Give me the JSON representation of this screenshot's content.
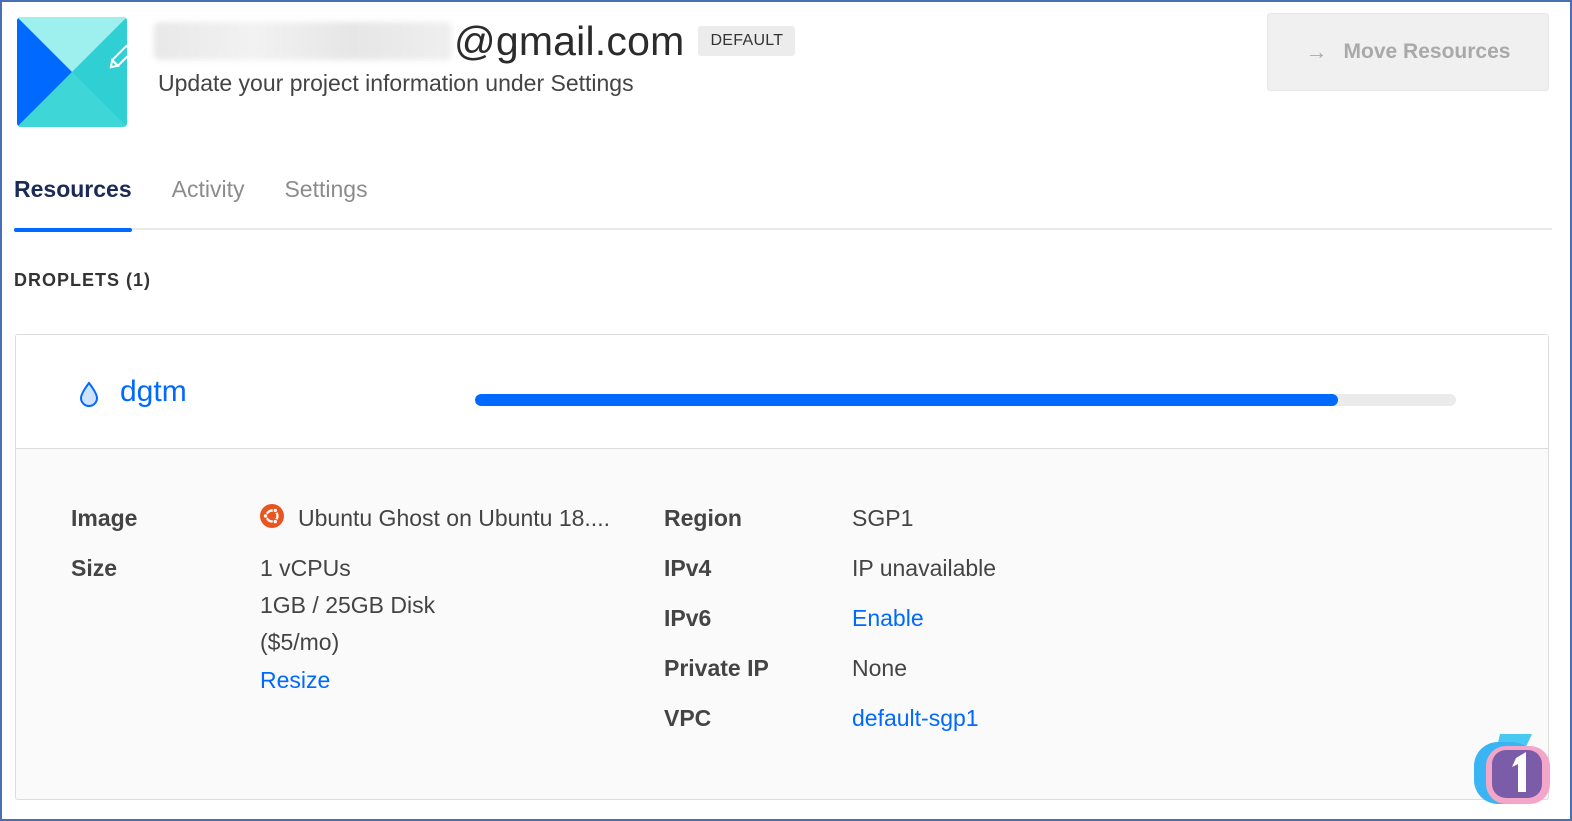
{
  "header": {
    "email_domain": "@gmail.com",
    "badge": "DEFAULT",
    "subtitle": "Update your project information under Settings",
    "move_button_label": "Move Resources"
  },
  "tabs": [
    {
      "label": "Resources",
      "active": true
    },
    {
      "label": "Activity",
      "active": false
    },
    {
      "label": "Settings",
      "active": false
    }
  ],
  "section": {
    "label": "DROPLETS (1)"
  },
  "droplet": {
    "name": "dgtm",
    "progress_fraction": 0.88,
    "details": {
      "image_label": "Image",
      "image_value": "Ubuntu Ghost on Ubuntu 18....",
      "size_label": "Size",
      "size_cpu": "1 vCPUs",
      "size_mem": "1GB / 25GB Disk",
      "size_price": "($5/mo)",
      "resize_link": "Resize",
      "region_label": "Region",
      "region_value": "SGP1",
      "ipv4_label": "IPv4",
      "ipv4_value": "IP unavailable",
      "ipv6_label": "IPv6",
      "ipv6_link": "Enable",
      "private_ip_label": "Private IP",
      "private_ip_value": "None",
      "vpc_label": "VPC",
      "vpc_link": "default-sgp1"
    }
  },
  "colors": {
    "accent": "#0069ff",
    "tab_active_text": "#1b2a56",
    "ubuntu_orange": "#e95420"
  }
}
